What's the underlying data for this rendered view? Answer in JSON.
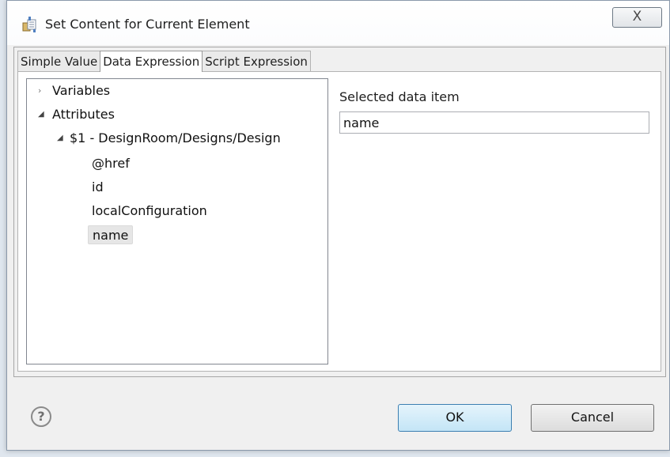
{
  "window": {
    "title": "Set Content for Current Element",
    "close_label": "X"
  },
  "tabs": [
    {
      "label": "Simple Value",
      "active": false
    },
    {
      "label": "Data Expression",
      "active": true
    },
    {
      "label": "Script Expression",
      "active": false
    }
  ],
  "tree": {
    "variables_label": "Variables",
    "attributes_label": "Attributes",
    "design_label": "$1 - DesignRoom/Designs/Design",
    "items": [
      "@href",
      "id",
      "localConfiguration",
      "name"
    ],
    "selected_item": "name"
  },
  "selected_data_item": {
    "label": "Selected data item",
    "value": "name"
  },
  "footer": {
    "help_label": "?",
    "ok_label": "OK",
    "cancel_label": "Cancel"
  },
  "colors": {
    "ok_button_bg": "#c4e5f6",
    "selection_bg": "#e6e6e6"
  }
}
